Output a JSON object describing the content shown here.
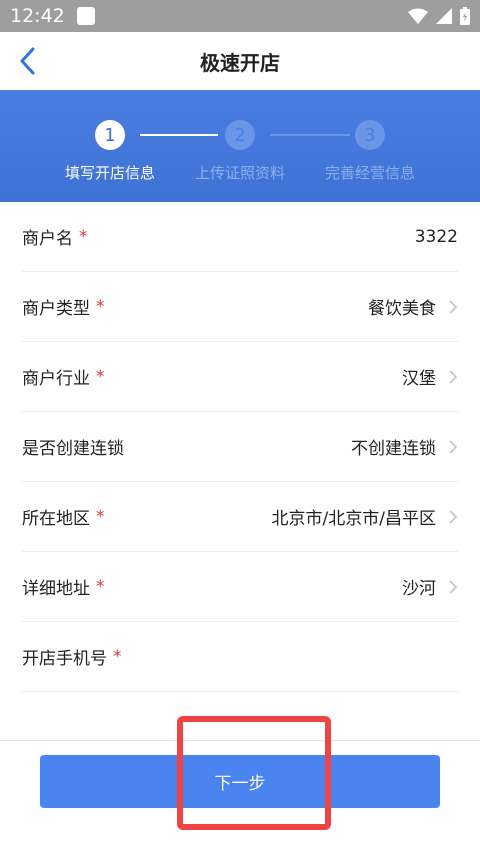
{
  "status": {
    "time": "12:42"
  },
  "header": {
    "title": "极速开店"
  },
  "steps": [
    {
      "number": "1",
      "label": "填写开店信息",
      "active": true
    },
    {
      "number": "2",
      "label": "上传证照资料",
      "active": false
    },
    {
      "number": "3",
      "label": "完善经营信息",
      "active": false
    }
  ],
  "form": {
    "rows": [
      {
        "label": "商户名",
        "required": "*",
        "value": "3322"
      },
      {
        "label": "商户类型",
        "required": "*",
        "value": "餐饮美食"
      },
      {
        "label": "商户行业",
        "required": "*",
        "value": "汉堡"
      },
      {
        "label": "是否创建连锁",
        "required": "",
        "value": "不创建连锁"
      },
      {
        "label": "所在地区",
        "required": "*",
        "value": "北京市/北京市/昌平区"
      },
      {
        "label": "详细地址",
        "required": "*",
        "value": "沙河"
      },
      {
        "label": "开店手机号",
        "required": "*",
        "value": ""
      }
    ]
  },
  "footer": {
    "next_label": "下一步"
  },
  "colors": {
    "accent": "#4a84ee",
    "banner": "#3e72d4",
    "required": "#e53935",
    "annotation": "#ef4444"
  }
}
